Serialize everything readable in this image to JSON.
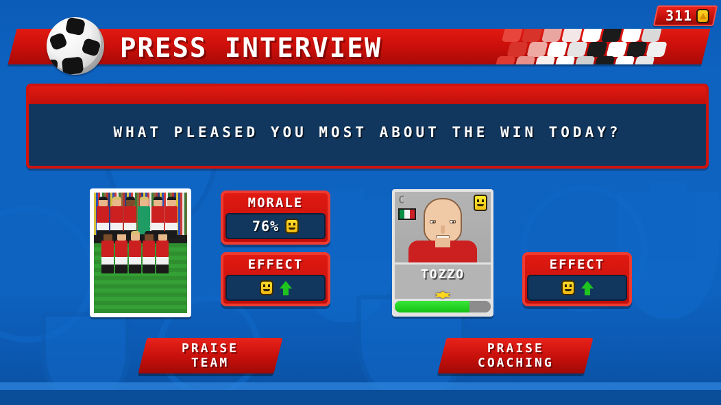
{
  "header": {
    "title": "PRESS INTERVIEW",
    "ball_icon": "soccer-ball-icon",
    "currency": {
      "value": "311",
      "icon": "coin-icon"
    }
  },
  "question": {
    "text": "WHAT PLEASED YOU MOST ABOUT THE WIN TODAY?"
  },
  "team_option": {
    "photo_alt": "team-squad-photo",
    "morale": {
      "title": "MORALE",
      "value": "76%",
      "mood_icon": "smiley-face-icon"
    },
    "effect": {
      "title": "EFFECT",
      "mood_icon": "smiley-face-icon",
      "trend_icon": "up-arrow-icon"
    },
    "button": {
      "line1": "PRAISE",
      "line2": "TEAM"
    }
  },
  "coach_option": {
    "card": {
      "position": "C",
      "nationality": "italy-flag",
      "mood_icon": "smiley-face-icon",
      "name": "TOZZO",
      "rating_icon": "star-icon",
      "fitness_percent": 78
    },
    "effect": {
      "title": "EFFECT",
      "mood_icon": "smiley-face-icon",
      "trend_icon": "up-arrow-icon"
    },
    "button": {
      "line1": "PRAISE",
      "line2": "COACHING"
    }
  },
  "colors": {
    "background_blue": "#0e62c0",
    "panel_red": "#cf130d",
    "panel_navy": "#12375e",
    "accent_yellow": "#ffd61e",
    "positive_green": "#1fc41f"
  }
}
